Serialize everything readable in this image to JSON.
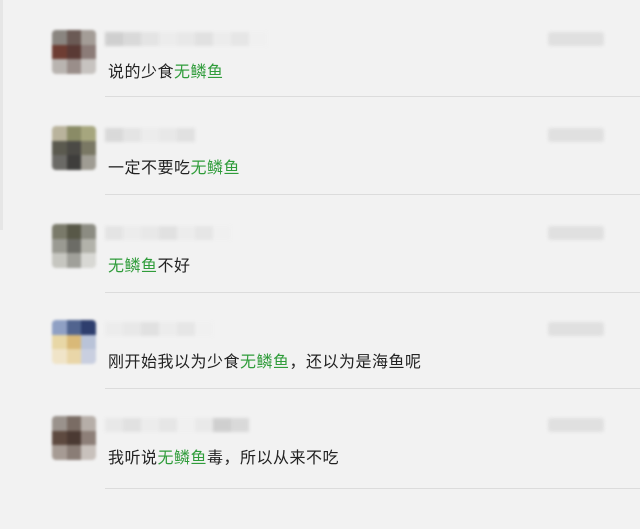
{
  "comments": [
    {
      "parts": [
        {
          "text": "说的少食",
          "hl": false
        },
        {
          "text": "无鳞鱼",
          "hl": true
        }
      ],
      "avatar": [
        "#8a8580",
        "#6b5a55",
        "#a49d97",
        "#6e3d33",
        "#5a3a35",
        "#8c7c78",
        "#b9b4b0",
        "#9a8e8a",
        "#c7c3c0"
      ]
    },
    {
      "parts": [
        {
          "text": "一定不要吃",
          "hl": false
        },
        {
          "text": "无鳞鱼",
          "hl": true
        }
      ],
      "avatar": [
        "#b9b39c",
        "#8a8b66",
        "#a6a67e",
        "#5b5a4f",
        "#4b4a45",
        "#7a7864",
        "#6b6a66",
        "#3f3e3c",
        "#9f9c93"
      ]
    },
    {
      "parts": [
        {
          "text": "无鳞鱼",
          "hl": true
        },
        {
          "text": "不好",
          "hl": false
        }
      ],
      "avatar": [
        "#7a7a6a",
        "#585848",
        "#8c8c82",
        "#9a9a92",
        "#6c6c66",
        "#b2b2aa",
        "#c6c6c0",
        "#a0a09a",
        "#d8d8d4"
      ]
    },
    {
      "parts": [
        {
          "text": "刚开始我以为少食",
          "hl": false
        },
        {
          "text": "无鳞鱼",
          "hl": true
        },
        {
          "text": "，还以为是海鱼呢",
          "hl": false
        }
      ],
      "avatar": [
        "#8fa0c4",
        "#51648f",
        "#2e3e6e",
        "#e8d7a6",
        "#d9b978",
        "#b9c3d8",
        "#f0e4c8",
        "#e9d6a8",
        "#c9cfe0"
      ]
    },
    {
      "parts": [
        {
          "text": "我听说",
          "hl": false
        },
        {
          "text": "无鳞鱼",
          "hl": true
        },
        {
          "text": "毒，所以从来不吃",
          "hl": false
        }
      ],
      "avatar": [
        "#9a928c",
        "#7a6c64",
        "#b6aea8",
        "#5e4a40",
        "#4b3a33",
        "#8d7f78",
        "#a69b94",
        "#8a7d76",
        "#c8c1bc"
      ]
    }
  ],
  "colors": {
    "highlight": "#2f9c3a",
    "text": "#222222",
    "background": "#f2f2f2"
  }
}
